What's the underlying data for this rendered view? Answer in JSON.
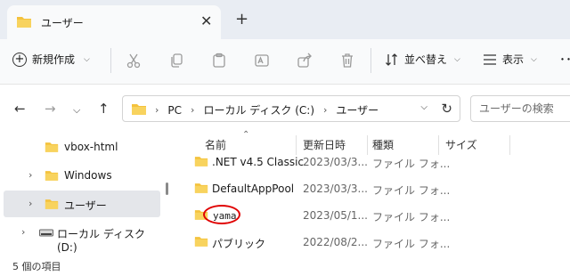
{
  "tab": {
    "title": "ユーザー",
    "close": "✕",
    "new_tab": "+"
  },
  "toolbar": {
    "new_label": "新規作成",
    "sort_label": "並べ替え",
    "view_label": "表示",
    "more": "･･･"
  },
  "address": {
    "crumbs": [
      "PC",
      "ローカル ディスク (C:)",
      "ユーザー"
    ],
    "search_placeholder": "ユーザーの検索"
  },
  "nav": {
    "items": [
      {
        "label": "vbox-html",
        "chevron": ""
      },
      {
        "label": "Windows",
        "chevron": "›"
      },
      {
        "label": "ユーザー",
        "chevron": "›",
        "selected": true
      },
      {
        "label": "ローカル ディスク (D:)",
        "chevron": "›"
      }
    ]
  },
  "list": {
    "columns": [
      "名前",
      "更新日時",
      "種類",
      "サイズ"
    ],
    "rows": [
      {
        "name": ".NET v4.5 Classic",
        "date": "2023/03/3...",
        "type": "ファイル フォ..."
      },
      {
        "name": "DefaultAppPool",
        "date": "2023/03/3...",
        "type": "ファイル フォ..."
      },
      {
        "name": "yama",
        "date": "2023/05/1...",
        "type": "ファイル フォ..."
      },
      {
        "name": "パブリック",
        "date": "2022/08/2...",
        "type": "ファイル フォ..."
      }
    ]
  },
  "status": {
    "item_count": "5 個の項目"
  },
  "colors": {
    "folder": "#f4c23d",
    "folder_dark": "#e3a92a",
    "highlight": "#e00000",
    "selected": "#e4e6ea"
  }
}
